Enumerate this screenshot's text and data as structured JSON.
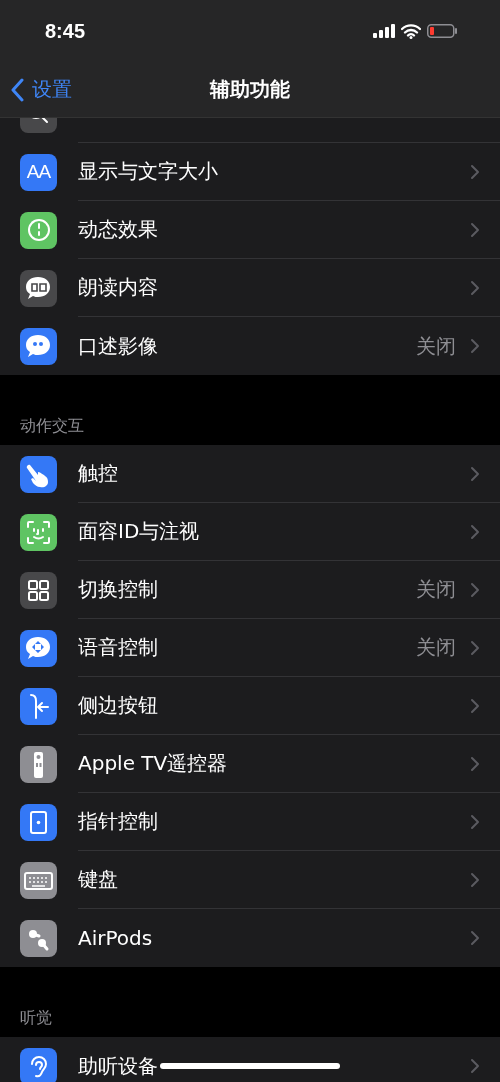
{
  "status_bar": {
    "time": "8:45",
    "battery_low": true
  },
  "nav": {
    "back": "设置",
    "title": "辅助功能"
  },
  "sections": [
    {
      "items": [
        {
          "kind": "cut",
          "color": "#48484a"
        },
        {
          "kind": "row",
          "label": "显示与文字大小",
          "icon_text": "AA",
          "color": "#3478f6"
        },
        {
          "kind": "row",
          "label": "动态效果",
          "color": "#5fc463"
        },
        {
          "kind": "row",
          "label": "朗读内容",
          "color": "#48484a"
        },
        {
          "kind": "row",
          "label": "口述影像",
          "value": "关闭",
          "color": "#3478f6"
        }
      ]
    },
    {
      "header": "动作交互",
      "items": [
        {
          "kind": "row",
          "label": "触控",
          "color": "#3478f6"
        },
        {
          "kind": "row",
          "label": "面容ID与注视",
          "color": "#5fc463"
        },
        {
          "kind": "row",
          "label": "切换控制",
          "value": "关闭",
          "color": "#48484a"
        },
        {
          "kind": "row",
          "label": "语音控制",
          "value": "关闭",
          "color": "#3478f6"
        },
        {
          "kind": "row",
          "label": "侧边按钮",
          "color": "#3478f6"
        },
        {
          "kind": "row",
          "label": "Apple TV遥控器",
          "color": "#8e8e93"
        },
        {
          "kind": "row",
          "label": "指针控制",
          "color": "#3478f6"
        },
        {
          "kind": "row",
          "label": "键盘",
          "color": "#8e8e93"
        },
        {
          "kind": "row",
          "label": "AirPods",
          "color": "#8e8e93"
        }
      ]
    },
    {
      "header": "听觉",
      "items": [
        {
          "kind": "row",
          "label": "助听设备",
          "color": "#3478f6"
        }
      ]
    }
  ]
}
